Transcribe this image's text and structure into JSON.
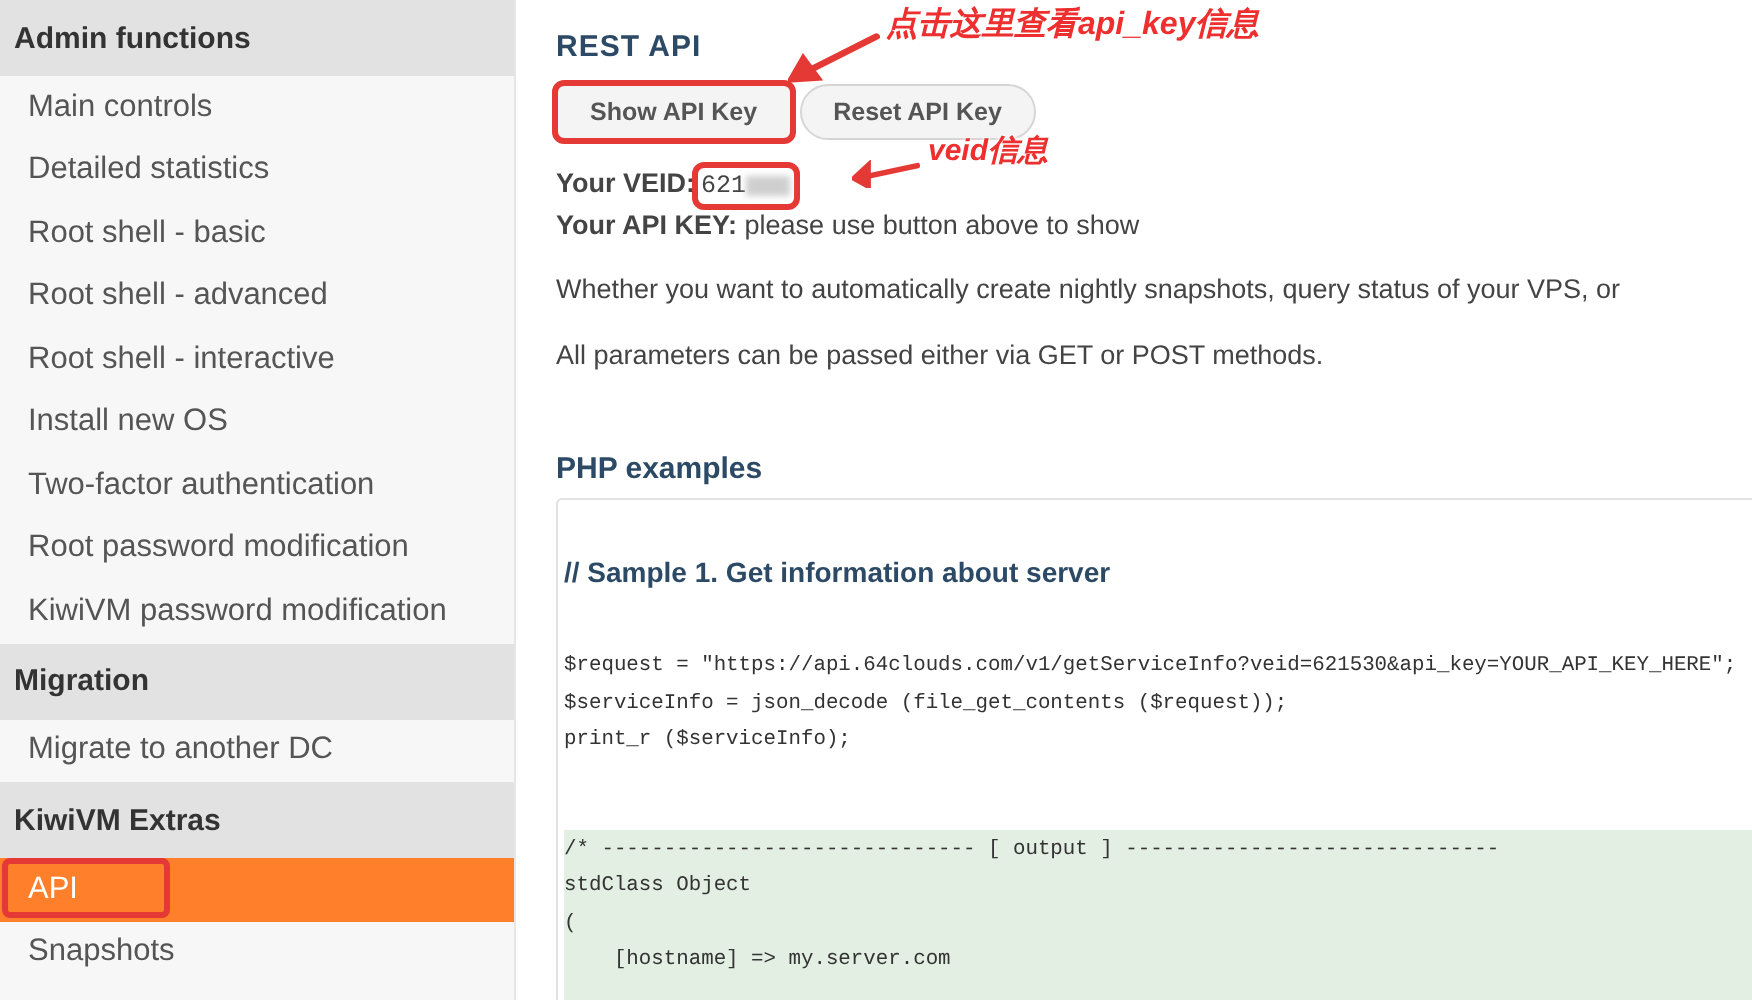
{
  "sidebar": {
    "sections": [
      {
        "title": "Admin functions",
        "items": [
          {
            "label": "Main controls",
            "selected": false,
            "highlighted": false
          },
          {
            "label": "Detailed statistics",
            "selected": false,
            "highlighted": false
          },
          {
            "label": "Root shell - basic",
            "selected": false,
            "highlighted": false
          },
          {
            "label": "Root shell - advanced",
            "selected": false,
            "highlighted": false
          },
          {
            "label": "Root shell - interactive",
            "selected": false,
            "highlighted": false
          },
          {
            "label": "Install new OS",
            "selected": false,
            "highlighted": false
          },
          {
            "label": "Two-factor authentication",
            "selected": false,
            "highlighted": false
          },
          {
            "label": "Root password modification",
            "selected": false,
            "highlighted": false
          },
          {
            "label": "KiwiVM password modification",
            "selected": false,
            "highlighted": false
          }
        ]
      },
      {
        "title": "Migration",
        "items": [
          {
            "label": "Migrate to another DC",
            "selected": false,
            "highlighted": false
          }
        ]
      },
      {
        "title": "KiwiVM Extras",
        "items": [
          {
            "label": "API",
            "selected": true,
            "highlighted": true
          },
          {
            "label": "Snapshots",
            "selected": false,
            "highlighted": false
          }
        ]
      }
    ]
  },
  "main": {
    "title": "REST API",
    "buttons": [
      {
        "label": "Show API Key",
        "highlighted": true,
        "callout": "点击这里查看api_key信息"
      },
      {
        "label": "Reset API Key",
        "highlighted": false
      }
    ],
    "veid": {
      "label": "Your VEID:",
      "value": "621",
      "blurred": true,
      "highlighted": true,
      "callout": "veid信息"
    },
    "api_key": {
      "label": "Your API KEY:",
      "value": "please use button above to show"
    },
    "paragraphs": [
      "Whether you want to automatically create nightly snapshots, query status of your VPS, or",
      "All parameters can be passed either via GET or POST methods."
    ],
    "examples_title": "PHP examples",
    "code": {
      "heading": "// Sample 1. Get information about server",
      "lines": [
        "$request = \"https://api.64clouds.com/v1/getServiceInfo?veid=621530&api_key=YOUR_API_KEY_HERE\";",
        "$serviceInfo = json_decode (file_get_contents ($request));",
        "print_r ($serviceInfo);"
      ],
      "output_lines": [
        "/* ------------------------------ [ output ] ------------------------------",
        "stdClass Object",
        "(",
        "    [hostname] => my.server.com"
      ]
    }
  }
}
